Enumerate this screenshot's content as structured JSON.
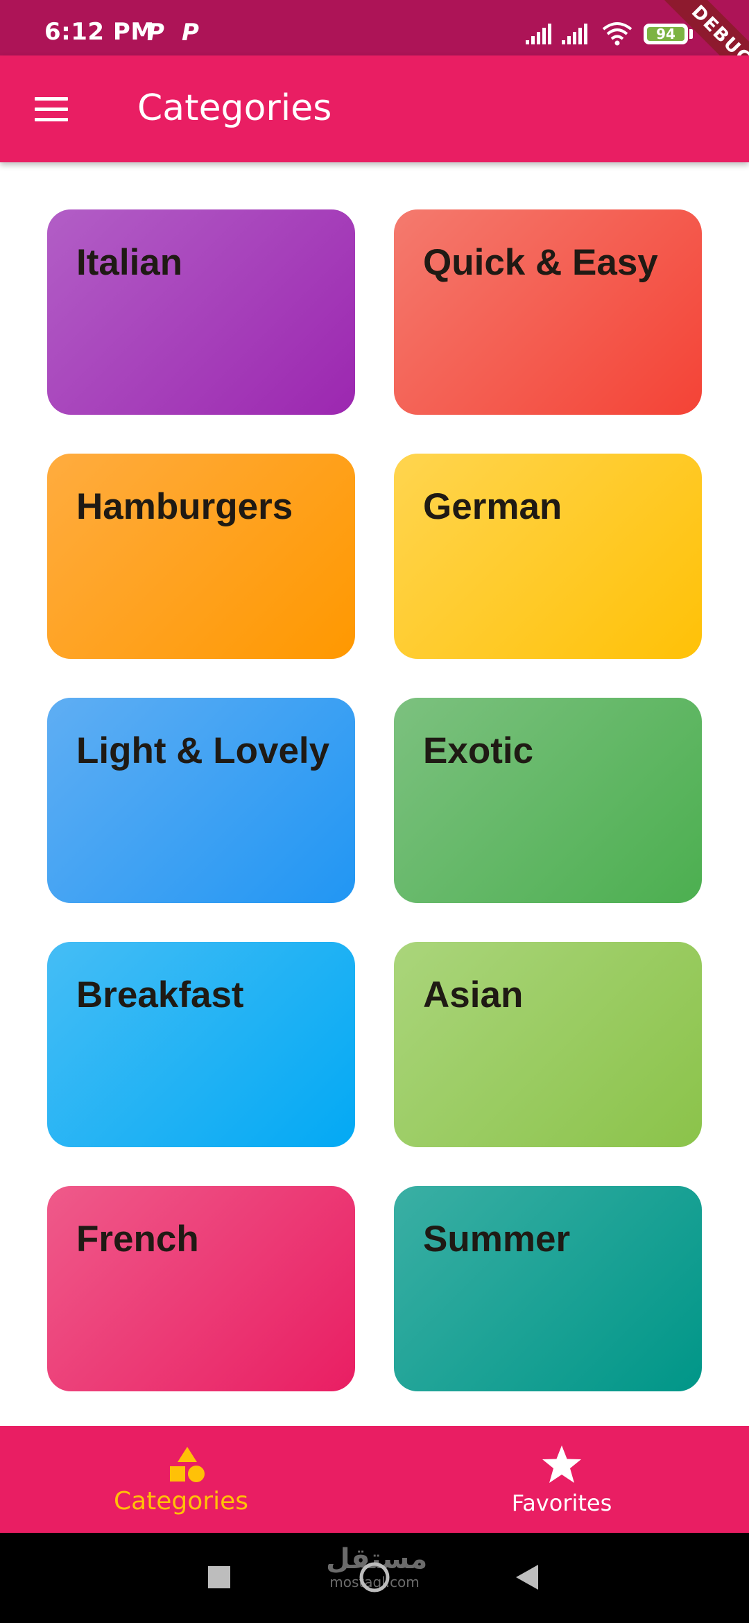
{
  "status_bar": {
    "time": "6:12 PM",
    "notification_icons": [
      "P",
      "P"
    ],
    "battery_level": "94",
    "debug_banner": "DEBUG"
  },
  "app_bar": {
    "title": "Categories",
    "menu_icon": "hamburger-menu-icon"
  },
  "categories": [
    {
      "title": "Italian",
      "color_from": "#b25ec6",
      "color_to": "#9c27b0"
    },
    {
      "title": "Quick & Easy",
      "color_from": "#f47a6e",
      "color_to": "#f44336"
    },
    {
      "title": "Hamburgers",
      "color_from": "#ffac3f",
      "color_to": "#ff9800"
    },
    {
      "title": "German",
      "color_from": "#ffd54f",
      "color_to": "#ffc107"
    },
    {
      "title": "Light & Lovely",
      "color_from": "#5faef3",
      "color_to": "#2196f3"
    },
    {
      "title": "Exotic",
      "color_from": "#7cc17f",
      "color_to": "#4caf50"
    },
    {
      "title": "Breakfast",
      "color_from": "#45bdf5",
      "color_to": "#03a9f4"
    },
    {
      "title": "Asian",
      "color_from": "#aad57b",
      "color_to": "#8bc34a"
    },
    {
      "title": "French",
      "color_from": "#ef5a8a",
      "color_to": "#e91e63"
    },
    {
      "title": "Summer",
      "color_from": "#3aafa4",
      "color_to": "#009688"
    }
  ],
  "bottom_nav": {
    "items": [
      {
        "label": "Categories",
        "icon": "category-shapes-icon",
        "active": true
      },
      {
        "label": "Favorites",
        "icon": "star-icon",
        "active": false
      }
    ],
    "active_color": "#ffc107",
    "inactive_color": "#ffffff"
  },
  "system_nav": {
    "buttons": [
      "recents-square-icon",
      "home-circle-icon",
      "back-triangle-icon"
    ],
    "watermark_arabic": "مستقل",
    "watermark_text": "mostaql.com"
  }
}
